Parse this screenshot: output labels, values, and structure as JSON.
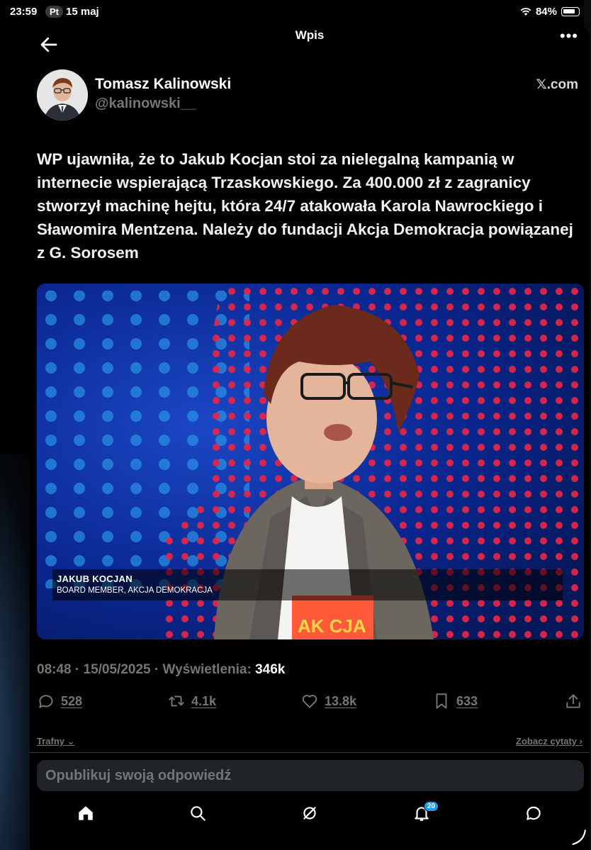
{
  "status_bar": {
    "time": "23:59",
    "day_pill": "Pt",
    "date_rest": "15 maj",
    "battery": "84%"
  },
  "nav": {
    "title": "Wpis"
  },
  "author": {
    "name": "Tomasz Kalinowski",
    "handle": "@kalinowski__",
    "source": "𝕏.com"
  },
  "tweet": {
    "text": "WP ujawniła, że to Jakub Kocjan stoi za nielegalną kampanią w internecie wspierającą Trzaskowskiego. Za 400.000 zł z zagranicy stworzył machinę hejtu, która 24/7 atakowała Karola Nawrockiego i Sławomira Mentzena. Należy do fundacji Akcja Demokracja powiązanej z G. Sorosem",
    "chyron_name": "JAKUB KOCJAN",
    "chyron_role": "BOARD MEMBER, AKCJA DEMOKRACJA",
    "shirt_text": "AK CJA"
  },
  "meta": {
    "time": "08:48",
    "date": "15/05/2025",
    "views_label": "Wyświetlenia:",
    "views_value": "346k"
  },
  "actions": {
    "replies": "528",
    "reposts": "4.1k",
    "likes": "13.8k",
    "bookmarks": "633"
  },
  "sort": {
    "left": "Trafny",
    "right": "Zobacz cytaty"
  },
  "reply_box": {
    "placeholder": "Opublikuj swoją odpowiedź"
  },
  "tabbar": {
    "notifications_badge": "20"
  },
  "colors": {
    "accent": "#1d9bf0",
    "muted": "#71767b",
    "background": "#000000"
  }
}
